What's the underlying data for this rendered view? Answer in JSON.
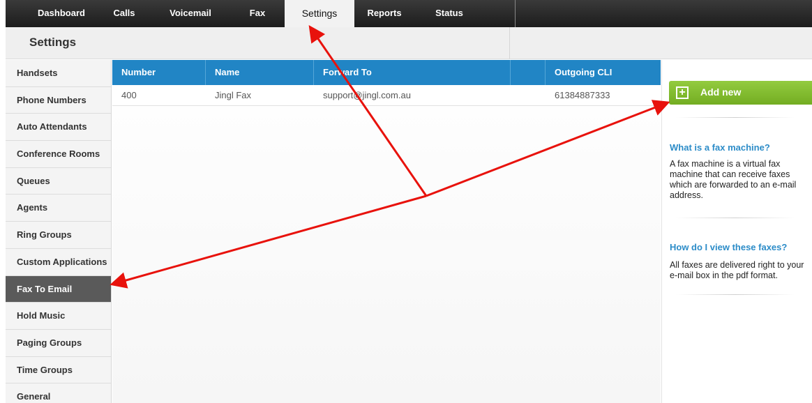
{
  "nav": {
    "items": [
      {
        "label": "Dashboard"
      },
      {
        "label": "Calls"
      },
      {
        "label": "Voicemail"
      },
      {
        "label": "Fax"
      },
      {
        "label": "Settings",
        "active": true
      },
      {
        "label": "Reports"
      },
      {
        "label": "Status"
      }
    ]
  },
  "page_title": "Settings",
  "sidebar": {
    "items": [
      {
        "label": "Handsets"
      },
      {
        "label": "Phone Numbers"
      },
      {
        "label": "Auto Attendants"
      },
      {
        "label": "Conference Rooms"
      },
      {
        "label": "Queues"
      },
      {
        "label": "Agents"
      },
      {
        "label": "Ring Groups"
      },
      {
        "label": "Custom Applications"
      },
      {
        "label": "Fax To Email",
        "active": true
      },
      {
        "label": "Hold Music"
      },
      {
        "label": "Paging Groups"
      },
      {
        "label": "Time Groups"
      },
      {
        "label": "General"
      }
    ]
  },
  "table": {
    "columns": [
      "Number",
      "Name",
      "Forward To",
      "",
      "Outgoing CLI"
    ],
    "rows": [
      [
        "400",
        "Jingl Fax",
        "support@jingl.com.au",
        "",
        "61384887333"
      ]
    ]
  },
  "right_panel": {
    "add_label": "Add new",
    "sections": [
      {
        "title": "What is a fax machine?",
        "text": "A fax machine is a virtual fax machine that can receive faxes which are forwarded to an e-mail address."
      },
      {
        "title": "How do I view these faxes?",
        "text": "All faxes are delivered right to your e-mail box in the pdf format."
      }
    ]
  },
  "colors": {
    "nav_bg": "#2a2a2a",
    "table_header": "#2185c5",
    "add_button": "#84bd32",
    "help_title": "#2c8cc8",
    "active_side": "#5a5a5a",
    "annotation_arrow": "#e8120c"
  }
}
